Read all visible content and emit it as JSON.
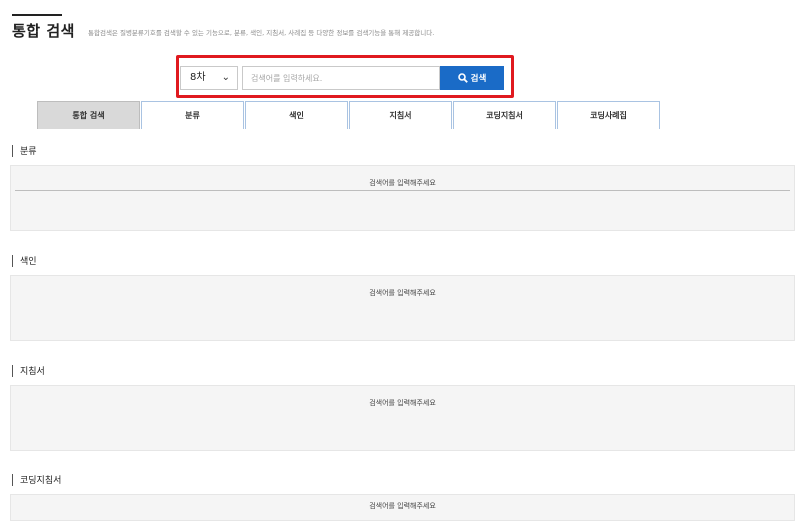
{
  "header": {
    "title": "통합 검색",
    "description": "통합검색은 질병분류기호를 검색할 수 있는 기능으로, 분류, 색인, 지침서, 사례집 등 다양한 정보를 검색기능을 통해 제공합니다."
  },
  "search": {
    "version_value": "8차",
    "placeholder": "검색어를 입력하세요.",
    "button_label": "검색",
    "highlight_color": "#e0191f",
    "button_color": "#1a6bc7"
  },
  "tabs": [
    {
      "label": "통합 검색",
      "active": true
    },
    {
      "label": "분류"
    },
    {
      "label": "색인"
    },
    {
      "label": "지침서"
    },
    {
      "label": "코딩지침서"
    },
    {
      "label": "코딩사례집"
    }
  ],
  "sections": [
    {
      "title": "분류",
      "message": "검색어를 입력해주세요"
    },
    {
      "title": "색인",
      "message": "검색어를 입력해주세요"
    },
    {
      "title": "지침서",
      "message": "검색어를 입력해주세요"
    },
    {
      "title": "코딩지침서",
      "message": "검색어를 입력해주세요"
    }
  ]
}
